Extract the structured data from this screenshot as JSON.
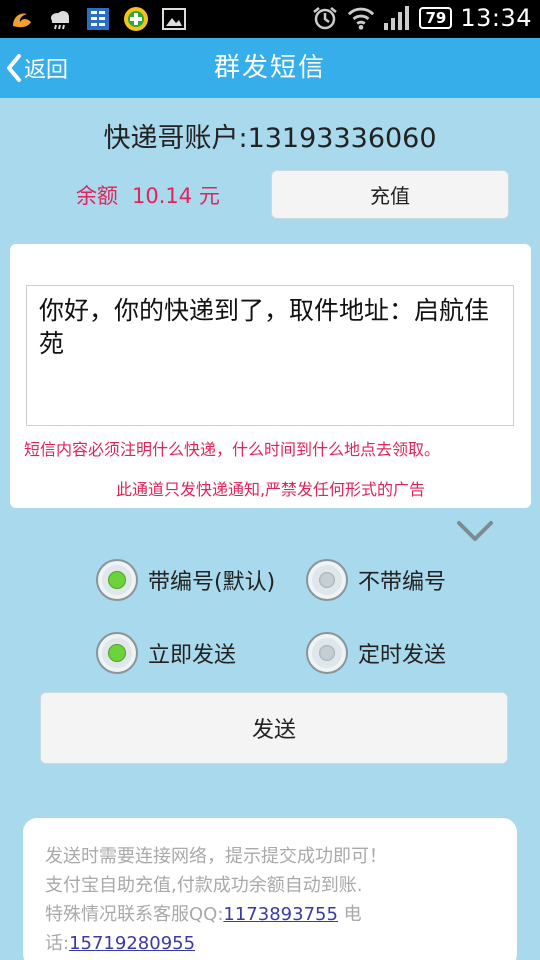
{
  "status_bar": {
    "time": "13:34",
    "battery": "79",
    "left_icons": [
      "uc-browser-icon",
      "cloud-icon",
      "app-grid-icon",
      "game-icon",
      "image-icon"
    ],
    "right_icons": [
      "alarm-icon",
      "wifi-icon",
      "signal-icon"
    ]
  },
  "title_bar": {
    "back_label": "返回",
    "title": "群发短信"
  },
  "account": {
    "text": "快递哥账户:13193336060"
  },
  "balance": {
    "label": "余额",
    "amount": "10.14",
    "unit": "元"
  },
  "recharge_button": "充值",
  "message": {
    "value": "你好，你的快递到了，取件地址：启航佳苑",
    "hint": "短信内容必须注明什么快递，什么时间到什么地点去领取。",
    "warning": "此通道只发快递通知,严禁发任何形式的广告"
  },
  "numbering_options": [
    {
      "label": "带编号(默认)",
      "selected": true
    },
    {
      "label": "不带编号",
      "selected": false
    }
  ],
  "timing_options": [
    {
      "label": "立即发送",
      "selected": true
    },
    {
      "label": "定时发送",
      "selected": false
    }
  ],
  "send_button": "发送",
  "notice": {
    "line1": "发送时需要连接网络，提示提交成功即可！",
    "line2": "支付宝自助充值,付款成功余额自动到账.",
    "line3_prefix": "特殊情况联系客服QQ:",
    "qq": "1173893755",
    "phone_label": "电话:",
    "phone": "15719280955"
  },
  "colors": {
    "background": "#a9d9ec",
    "title_bar": "#36aee9",
    "accent_red": "#e0245a",
    "radio_selected": "#6cd33a",
    "link": "#3a3aa6"
  }
}
